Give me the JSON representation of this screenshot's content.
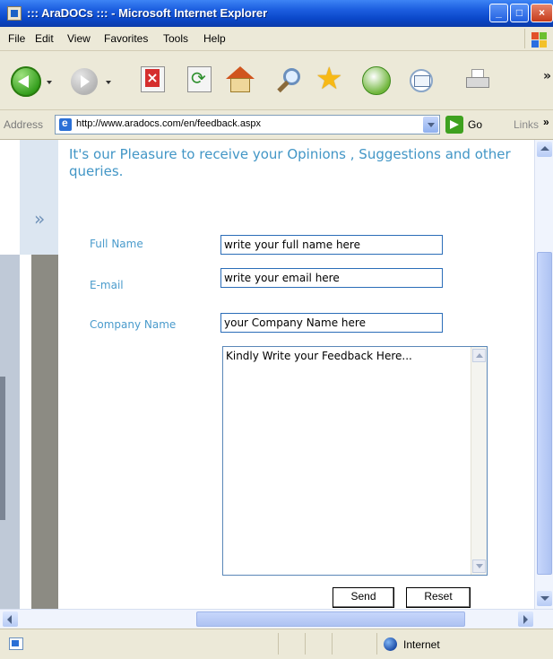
{
  "window": {
    "title": "::: AraDOCs ::: - Microsoft Internet Explorer"
  },
  "menu": {
    "items": [
      "File",
      "Edit",
      "View",
      "Favorites",
      "Tools",
      "Help"
    ]
  },
  "address": {
    "label": "Address",
    "url": "http://www.aradocs.com/en/feedback.aspx",
    "go_label": "Go",
    "links_label": "Links"
  },
  "page": {
    "intro": "It's our Pleasure to receive your Opinions , Suggestions and other queries.",
    "sidebar_arrow": "»",
    "form": {
      "full_name_label": "Full Name",
      "email_label": "E-mail",
      "company_label": "Company Name",
      "full_name_value": "write your full name here",
      "email_value": "write your email here",
      "company_value": "your Company Name here",
      "feedback_value": "Kindly Write your Feedback Here...",
      "send_label": "Send",
      "reset_label": "Reset"
    }
  },
  "status": {
    "zone": "Internet"
  },
  "icons": {
    "back": "back-arrow-icon",
    "forward": "forward-arrow-icon",
    "stop": "stop-icon",
    "refresh": "refresh-icon",
    "home": "home-icon",
    "search": "search-icon",
    "favorites": "favorites-star-icon",
    "media": "media-icon",
    "mail": "mail-icon",
    "print": "print-icon"
  }
}
